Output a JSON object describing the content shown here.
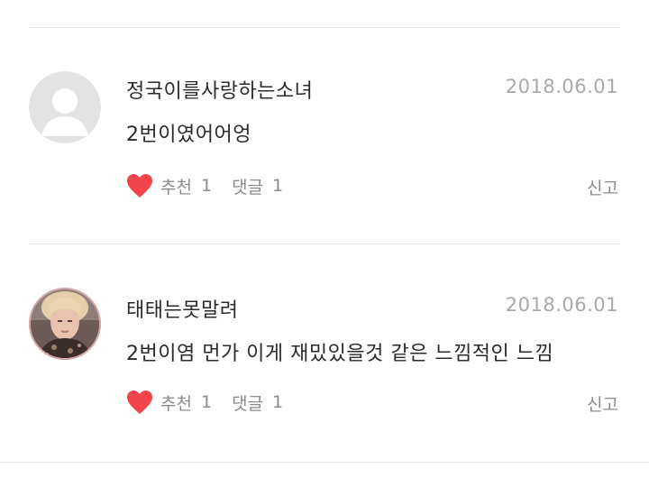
{
  "comments": [
    {
      "username": "정국이를사랑하는소녀",
      "date": "2018.06.01",
      "text": "2번이였어어엉",
      "avatar": "default-avatar",
      "like_label": "추천",
      "like_count": "1",
      "reply_label": "댓글",
      "reply_count": "1",
      "report_label": "신고"
    },
    {
      "username": "태태는못말려",
      "date": "2018.06.01",
      "text": "2번이염 먼가 이게 재밌있을것 같은 느낌적인 느낌",
      "avatar": "profile-photo",
      "like_label": "추천",
      "like_count": "1",
      "reply_label": "댓글",
      "reply_count": "1",
      "report_label": "신고"
    }
  ],
  "colors": {
    "heart": "#f2454b",
    "text": "#2b2b2b",
    "muted": "#8c8c8c",
    "date": "#a9a9a9",
    "divider": "#e6e6e6"
  }
}
